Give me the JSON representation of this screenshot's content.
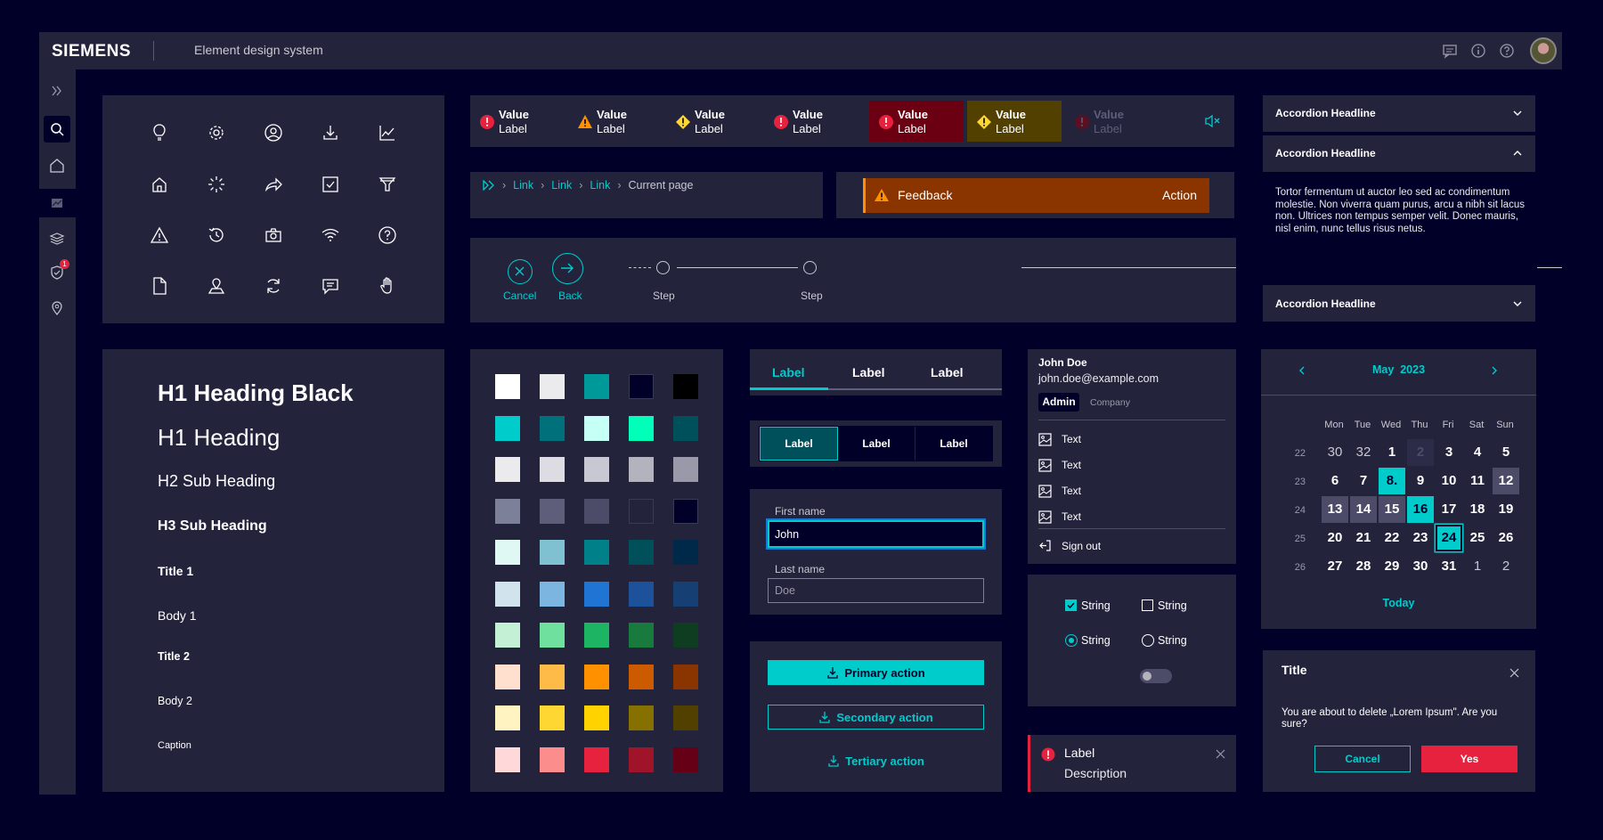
{
  "header": {
    "brand": "SIEMENS",
    "title": "Element design system"
  },
  "statusbar": {
    "items": [
      {
        "value": "Value",
        "label": "Label",
        "kind": "error"
      },
      {
        "value": "Value",
        "label": "Label",
        "kind": "warning"
      },
      {
        "value": "Value",
        "label": "Label",
        "kind": "caution"
      },
      {
        "value": "Value",
        "label": "Label",
        "kind": "error"
      },
      {
        "value": "Value",
        "label": "Label",
        "kind": "error-active"
      },
      {
        "value": "Value",
        "label": "Label",
        "kind": "caution-active"
      },
      {
        "value": "Value",
        "label": "Label",
        "kind": "disabled"
      }
    ]
  },
  "breadcrumb": {
    "items": [
      "Link",
      "Link",
      "Link"
    ],
    "current": "Current page"
  },
  "feedback": {
    "text": "Feedback",
    "action": "Action"
  },
  "wizard": {
    "cancel": "Cancel",
    "back": "Back",
    "steps": [
      "Step",
      "Step"
    ]
  },
  "accordion": {
    "items": [
      {
        "title": "Accordion Headline"
      },
      {
        "title": "Accordion Headline",
        "body": "Tortor fermentum ut auctor leo sed ac condimentum molestie. Non viverra quam purus, arcu a nibh sit lacus non. Ultrices non tempus semper velit. Donec mauris, nisl enim, nunc tellus risus netus."
      },
      {
        "title": "Accordion Headline"
      }
    ]
  },
  "typography": {
    "h1_black": "H1 Heading Black",
    "h1": "H1 Heading",
    "h2": "H2 Sub Heading",
    "h3": "H3 Sub Heading",
    "title1": "Title 1",
    "body1": "Body 1",
    "title2": "Title 2",
    "body2": "Body 2",
    "caption": "Caption"
  },
  "palette": [
    [
      "#ffffff",
      "#ebebee",
      "#009999",
      "#000028",
      "#000000"
    ],
    [
      "#00cccc",
      "#00707a",
      "#c5fff5",
      "#00ffb9",
      "#00505c"
    ],
    [
      "#ebebee",
      "#dcdce2",
      "#c8c8d2",
      "#b3b3be",
      "#9999a9"
    ],
    [
      "#7d8099",
      "#5e5e7a",
      "#4c4c68",
      "#23233c",
      "#000028"
    ],
    [
      "#dff8f4",
      "#7fc1d1",
      "#00818a",
      "#00505c",
      "#002949"
    ],
    [
      "#d1e4ee",
      "#7cb5e0",
      "#2074d4",
      "#1d5199",
      "#163f73"
    ],
    [
      "#c4f1d6",
      "#6fe09e",
      "#1db563",
      "#197a3e",
      "#0f3d21"
    ],
    [
      "#ffe0cf",
      "#ffbb47",
      "#ff9000",
      "#cc5b00",
      "#8a3500"
    ],
    [
      "#fff3c2",
      "#ffd732",
      "#ffd200",
      "#857000",
      "#524000"
    ],
    [
      "#ffd9d9",
      "#fc8d8d",
      "#e7223f",
      "#a0142a",
      "#660017"
    ]
  ],
  "tabs": {
    "items": [
      "Label",
      "Label",
      "Label"
    ]
  },
  "segmented": {
    "items": [
      "Label",
      "Label",
      "Label"
    ]
  },
  "form": {
    "first_label": "First name",
    "first_value": "John",
    "last_label": "Last name",
    "last_placeholder": "Doe"
  },
  "buttons": {
    "primary": "Primary action",
    "secondary": "Secondary action",
    "tertiary": "Tertiary action"
  },
  "user_menu": {
    "name": "John Doe",
    "email": "john.doe@example.com",
    "role": "Admin",
    "company": "Company",
    "items": [
      "Text",
      "Text",
      "Text",
      "Text"
    ],
    "sign_out": "Sign out"
  },
  "controls": {
    "checkbox_checked": "String",
    "checkbox_unchecked": "String",
    "radio_checked": "String",
    "radio_unchecked": "String"
  },
  "toast": {
    "label": "Label",
    "description": "Description"
  },
  "calendar": {
    "month": "May",
    "year": "2023",
    "weekdays": [
      "Mon",
      "Tue",
      "Wed",
      "Thu",
      "Fri",
      "Sat",
      "Sun"
    ],
    "weeks": [
      {
        "num": "22",
        "days": [
          "30",
          "32",
          "1",
          "2",
          "3",
          "4",
          "5"
        ]
      },
      {
        "num": "23",
        "days": [
          "6",
          "7",
          "8.",
          "9",
          "10",
          "11",
          "12"
        ]
      },
      {
        "num": "24",
        "days": [
          "13",
          "14",
          "15",
          "16",
          "17",
          "18",
          "19"
        ]
      },
      {
        "num": "25",
        "days": [
          "20",
          "21",
          "22",
          "23",
          "24",
          "25",
          "26"
        ]
      },
      {
        "num": "26",
        "days": [
          "27",
          "28",
          "29",
          "30",
          "31",
          "1",
          "2"
        ]
      }
    ],
    "today": "Today"
  },
  "dialog": {
    "title": "Title",
    "message": "You are about to delete „Lorem Ipsum\". Are you sure?",
    "cancel": "Cancel",
    "yes": "Yes"
  },
  "colors": {
    "accent": "#00cccc",
    "surface": "#23233c",
    "bg": "#000028",
    "danger": "#e7223f",
    "warning": "#ff9000",
    "caution": "#ffd732"
  }
}
